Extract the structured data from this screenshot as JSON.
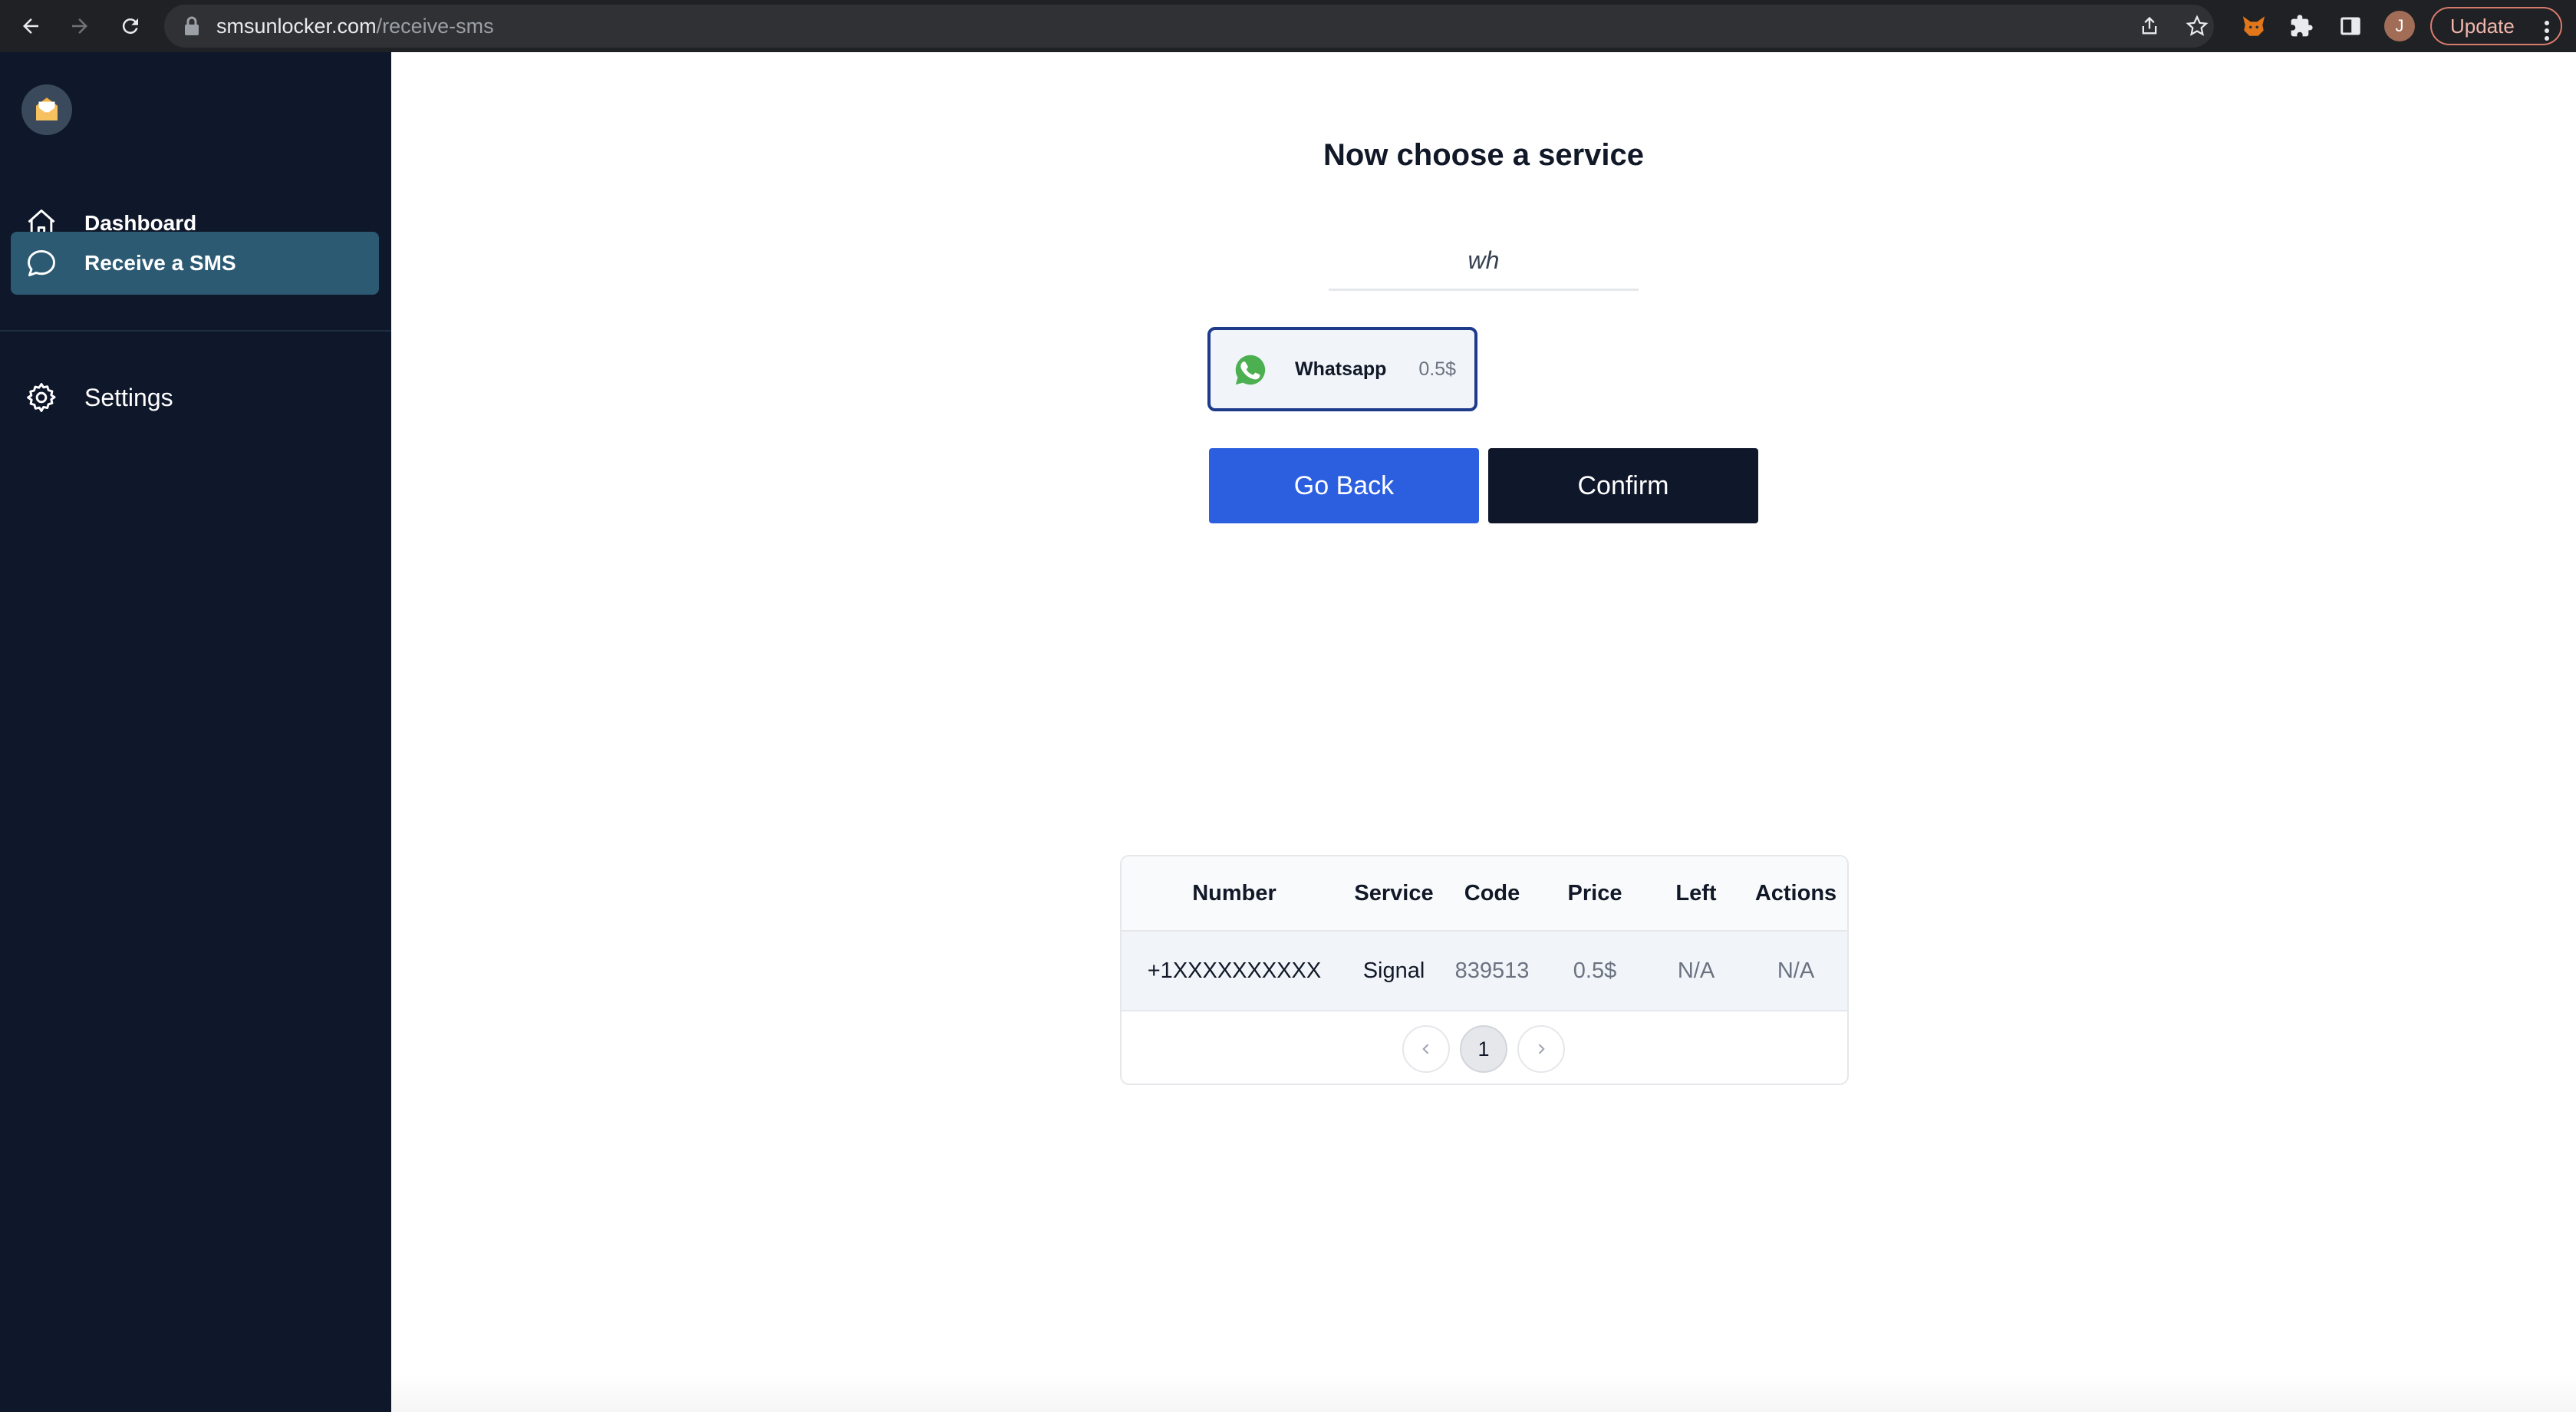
{
  "browser": {
    "url_host": "smsunlocker.com",
    "url_path": "/receive-sms",
    "profile_initial": "J",
    "update_label": "Update"
  },
  "sidebar": {
    "items": [
      {
        "label": "Dashboard",
        "icon": "home-icon"
      },
      {
        "label": "Receive a SMS",
        "icon": "chat-bubble-icon",
        "active": true
      }
    ],
    "settings_label": "Settings"
  },
  "main": {
    "title": "Now choose a service",
    "search": {
      "value": "wh"
    },
    "services": [
      {
        "name": "Whatsapp",
        "price": "0.5$",
        "icon": "whatsapp-icon",
        "selected": true
      }
    ],
    "buttons": {
      "back": "Go Back",
      "confirm": "Confirm"
    }
  },
  "table": {
    "columns": [
      "Number",
      "Service",
      "Code",
      "Price",
      "Left",
      "Actions"
    ],
    "rows": [
      {
        "number": "+1XXXXXXXXXX",
        "service": "Signal",
        "code": "839513",
        "price": "0.5$",
        "left": "N/A",
        "actions": "N/A"
      }
    ],
    "pagination": {
      "current_page": "1"
    }
  },
  "colors": {
    "sidebar_bg": "#0f172a",
    "sidebar_active": "#2b5a72",
    "primary_button": "#2c5fdf",
    "dark_button": "#0f172a",
    "selected_border": "#1e3a8a"
  }
}
